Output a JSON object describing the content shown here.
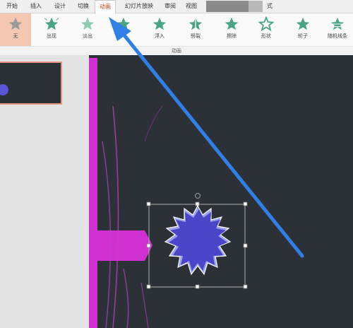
{
  "tabs": [
    {
      "label": "开始"
    },
    {
      "label": "插入"
    },
    {
      "label": "设计"
    },
    {
      "label": "切换"
    },
    {
      "label": "动画",
      "active": true
    },
    {
      "label": "幻灯片放映"
    },
    {
      "label": "审阅"
    },
    {
      "label": "视图"
    },
    {
      "label": "式"
    }
  ],
  "animations": [
    {
      "label": "无",
      "selected": true
    },
    {
      "label": "出现"
    },
    {
      "label": "淡出"
    },
    {
      "label": ""
    },
    {
      "label": "浮入"
    },
    {
      "label": "劈裂"
    },
    {
      "label": "擦除"
    },
    {
      "label": "形状"
    },
    {
      "label": "轮子"
    },
    {
      "label": "随机线条"
    }
  ],
  "group_label": "动画",
  "colors": {
    "accent_tab": "#c43e1c",
    "selected_anim": "#f4c7b3",
    "star_icon": "#4aa382",
    "slide_bg": "#2c3138",
    "magenta_bar": "#d030d0",
    "starburst": "#4b45c8",
    "arrow": "#2f7fe6"
  }
}
